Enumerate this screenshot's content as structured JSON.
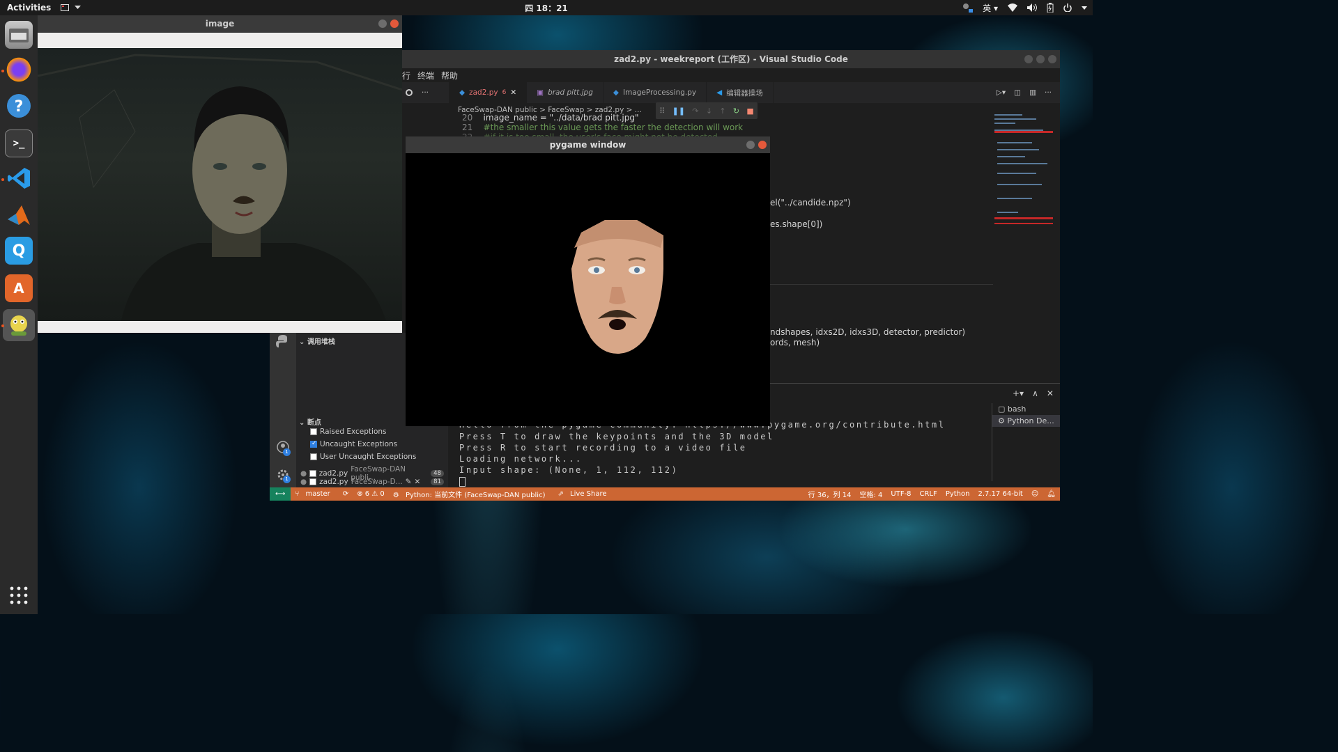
{
  "topbar": {
    "activities": "Activities",
    "clock": "四 18：21",
    "input_method": "英"
  },
  "dock": {
    "items": [
      "files-icon",
      "firefox-icon",
      "help-icon",
      "terminal-icon",
      "vscode-icon",
      "matlab-icon",
      "qq-icon",
      "software-center-icon",
      "python-snake-icon"
    ]
  },
  "image_window": {
    "title": "image"
  },
  "vscode": {
    "title": "zad2.py - weekreport (工作区) - Visual Studio Code",
    "menu": [
      "行",
      "终端",
      "帮助"
    ],
    "tabs": [
      {
        "label": "zad2.py",
        "badge": "6",
        "active": true
      },
      {
        "label": "brad pitt.jpg"
      },
      {
        "label": "ImageProcessing.py"
      },
      {
        "label": "编辑器操场"
      }
    ],
    "breadcrumb": "FaceSwap-DAN public  >  FaceSwap  >  zad2.py  >  ...",
    "code": [
      {
        "num": "20",
        "text": "image_name = \"../data/brad pitt.jpg\""
      },
      {
        "num": "21",
        "text": "#the smaller this value gets the faster the detection will work"
      },
      {
        "num": "22",
        "text": "#if it is too small, the user's face might not be detected"
      }
    ],
    "code_right": [
      "el(\"../candide.npz\")",
      "es.shape[0])",
      "ndshapes, idxs2D, idxs3D, detector, predictor)",
      "ords, mesh)"
    ]
  },
  "debug_panel": {
    "callstack": "调用堆栈",
    "breakpoints": "断点",
    "items": [
      {
        "label": "Raised Exceptions",
        "checked": false
      },
      {
        "label": "Uncaught Exceptions",
        "checked": true
      },
      {
        "label": "User Uncaught Exceptions",
        "checked": false
      }
    ],
    "bp_files": [
      {
        "file": "zad2.py",
        "path": "FaceSwap-DAN publi...",
        "line": "48"
      },
      {
        "file": "zad2.py",
        "path": "FaceSwap-D...",
        "line": "81"
      }
    ],
    "account_badge": "1",
    "settings_badge": "1"
  },
  "terminal": {
    "lines": [
      "Hello from the pygame community. https://www.pygame.org/contribute.html",
      "Press T to draw the keypoints and the 3D model",
      "Press R to start recording to a video file",
      "Loading network...",
      "Input shape: (None, 1, 112, 112)"
    ],
    "sessions": [
      "bash",
      "Python De..."
    ]
  },
  "statusbar": {
    "branch": "master",
    "problems": "⊗ 6 ⚠ 0",
    "python": "Python: 当前文件 (FaceSwap-DAN public)",
    "liveshare": "Live Share",
    "position": "行 36，列 14",
    "spaces": "空格: 4",
    "encoding": "UTF-8",
    "eol": "CRLF",
    "language": "Python",
    "interpreter": "2.7.17 64-bit"
  },
  "pygame": {
    "title": "pygame window"
  },
  "colors": {
    "statusbar": "#cc6633",
    "accent": "#e95420",
    "debug_toolbar": "#333333"
  }
}
